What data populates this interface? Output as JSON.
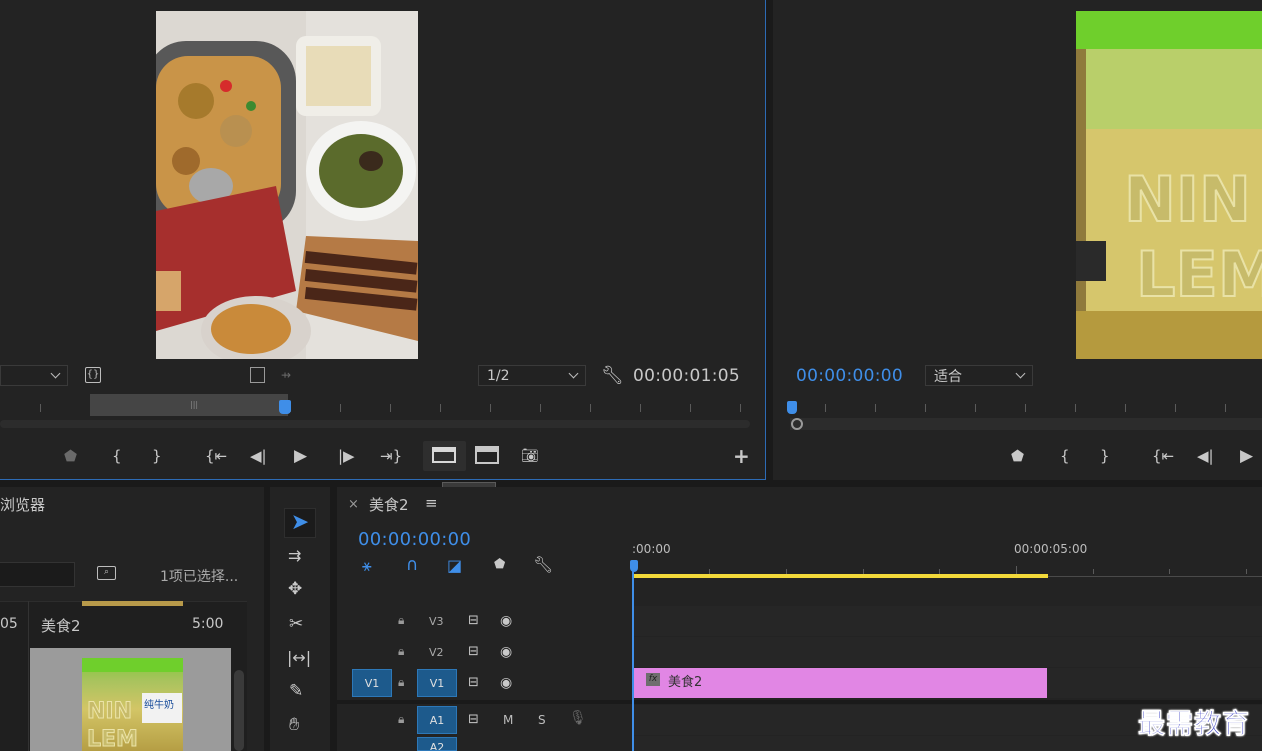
{
  "source_monitor": {
    "zoom_select": "",
    "resolution_select": "1/2",
    "timecode": "00:00:01:05",
    "tooltip": "插入 (,)"
  },
  "program_monitor": {
    "timecode": "00:00:00:00",
    "fit_select": "适合"
  },
  "project_panel": {
    "title": "浏览器",
    "selection_status": "1项已选择...",
    "column_left": "05",
    "item_name": "美食2",
    "item_duration": "5:00"
  },
  "timeline": {
    "sequence_name": "美食2",
    "timecode": "00:00:00:00",
    "ruler_start": ":00:00",
    "ruler_mark": "00:00:05:00",
    "tracks": {
      "v3": "V3",
      "v2": "V2",
      "v1_source": "V1",
      "v1": "V1",
      "a1": "A1",
      "a2": "A2",
      "mute": "M",
      "solo": "S"
    },
    "clip_name": "美食2",
    "clip_fx": "fx"
  },
  "watermark": "最需教育",
  "colors": {
    "accent_blue": "#3f8ee8",
    "clip_pink": "#e186e4",
    "work_area_yellow": "#f2d93a",
    "track_patch_blue": "#1d5a8c"
  }
}
